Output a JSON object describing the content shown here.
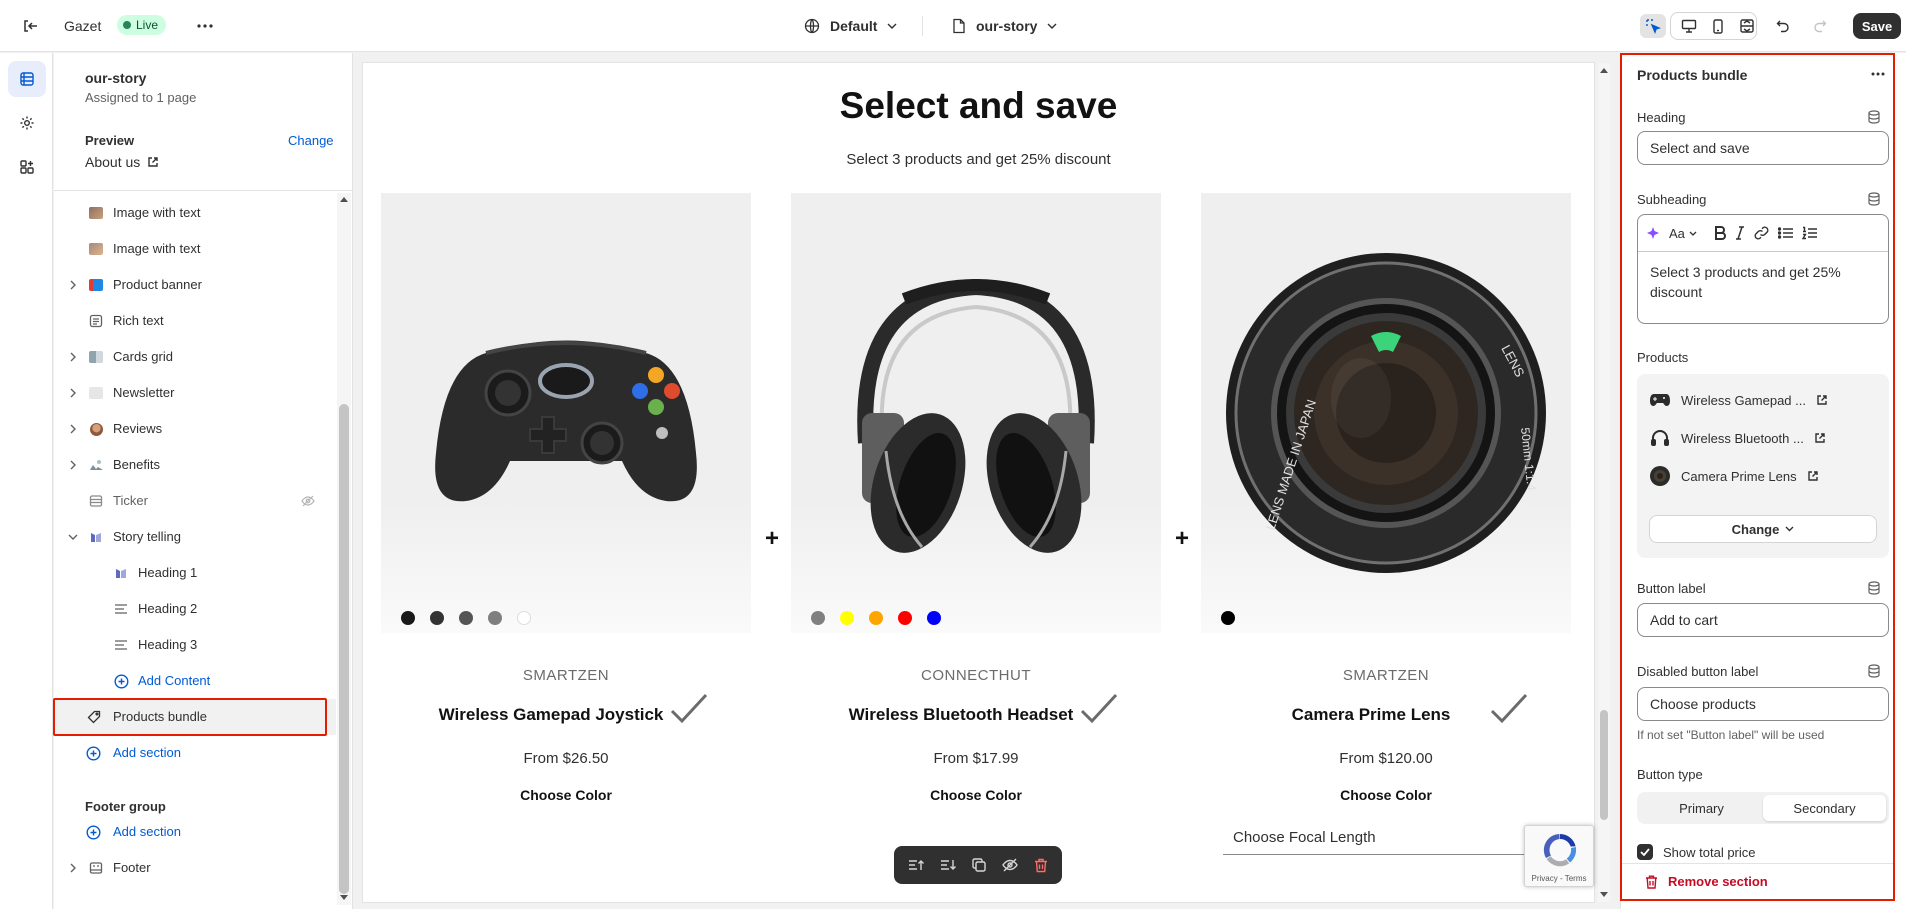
{
  "topbar": {
    "theme_name": "Gazet",
    "status_badge": "Live",
    "template_select": "Default",
    "page_select": "our-story",
    "save_label": "Save"
  },
  "sidebar": {
    "template_title": "our-story",
    "assigned": "Assigned to 1 page",
    "preview_label": "Preview",
    "change_link": "Change",
    "preview_page": "About us",
    "items": [
      {
        "label": "Image with text"
      },
      {
        "label": "Image with text"
      },
      {
        "label": "Product banner"
      },
      {
        "label": "Rich text"
      },
      {
        "label": "Cards grid"
      },
      {
        "label": "Newsletter"
      },
      {
        "label": "Reviews"
      },
      {
        "label": "Benefits"
      },
      {
        "label": "Ticker"
      },
      {
        "label": "Story telling"
      },
      {
        "label": "Heading 1"
      },
      {
        "label": "Heading 2"
      },
      {
        "label": "Heading 3"
      },
      {
        "label": "Add Content"
      },
      {
        "label": "Products bundle"
      },
      {
        "label": "Add section"
      }
    ],
    "footer_group": {
      "title": "Footer group",
      "add_section": "Add section",
      "footer": "Footer"
    }
  },
  "preview": {
    "heading": "Select and save",
    "subheading": "Select 3 products and get 25% discount",
    "products": [
      {
        "vendor": "SMARTZEN",
        "name": "Wireless Gamepad Joystick",
        "price": "From $26.50",
        "option": "Choose Color",
        "swatches": [
          "#1a1a1a",
          "#333333",
          "#555555",
          "#7f7f7f",
          "#ffffff"
        ]
      },
      {
        "vendor": "CONNECTHUT",
        "name": "Wireless Bluetooth Headset",
        "price": "From $17.99",
        "option": "Choose Color",
        "swatches": [
          "#808080",
          "#ffff00",
          "#ffa500",
          "#ff0000",
          "#0000ff"
        ]
      },
      {
        "vendor": "SMARTZEN",
        "name": "Camera Prime Lens",
        "price": "From $120.00",
        "option": "Choose Color",
        "swatches": [
          "#000000"
        ]
      }
    ],
    "focal_select": "Choose Focal Length",
    "recaptcha_footer": "Privacy - Terms",
    "lens_text": {
      "left": "LENS MADE IN JAPAN",
      "right": "LENS",
      "focal": "50mm 1:1.4"
    }
  },
  "settings": {
    "title": "Products bundle",
    "heading_label": "Heading",
    "heading_value": "Select and save",
    "subheading_label": "Subheading",
    "subheading_value": "Select 3 products and get 25% discount",
    "rte_font_button": "Aa",
    "products_label": "Products",
    "products": [
      {
        "name": "Wireless Gamepad ..."
      },
      {
        "name": "Wireless Bluetooth ..."
      },
      {
        "name": "Camera Prime Lens"
      }
    ],
    "change_label": "Change",
    "button_label_label": "Button label",
    "button_label_value": "Add to cart",
    "disabled_label": "Disabled button label",
    "disabled_value": "Choose products",
    "disabled_hint": "If not set \"Button label\" will be used",
    "button_type_label": "Button type",
    "button_type_options": [
      "Primary",
      "Secondary"
    ],
    "button_type_selected": "Secondary",
    "show_total_label": "Show total price",
    "remove_label": "Remove section"
  },
  "colors": {
    "accent": "#005bd3",
    "highlight": "#e51c00",
    "live_bg": "#cdfee1",
    "danger": "#c70a24"
  }
}
